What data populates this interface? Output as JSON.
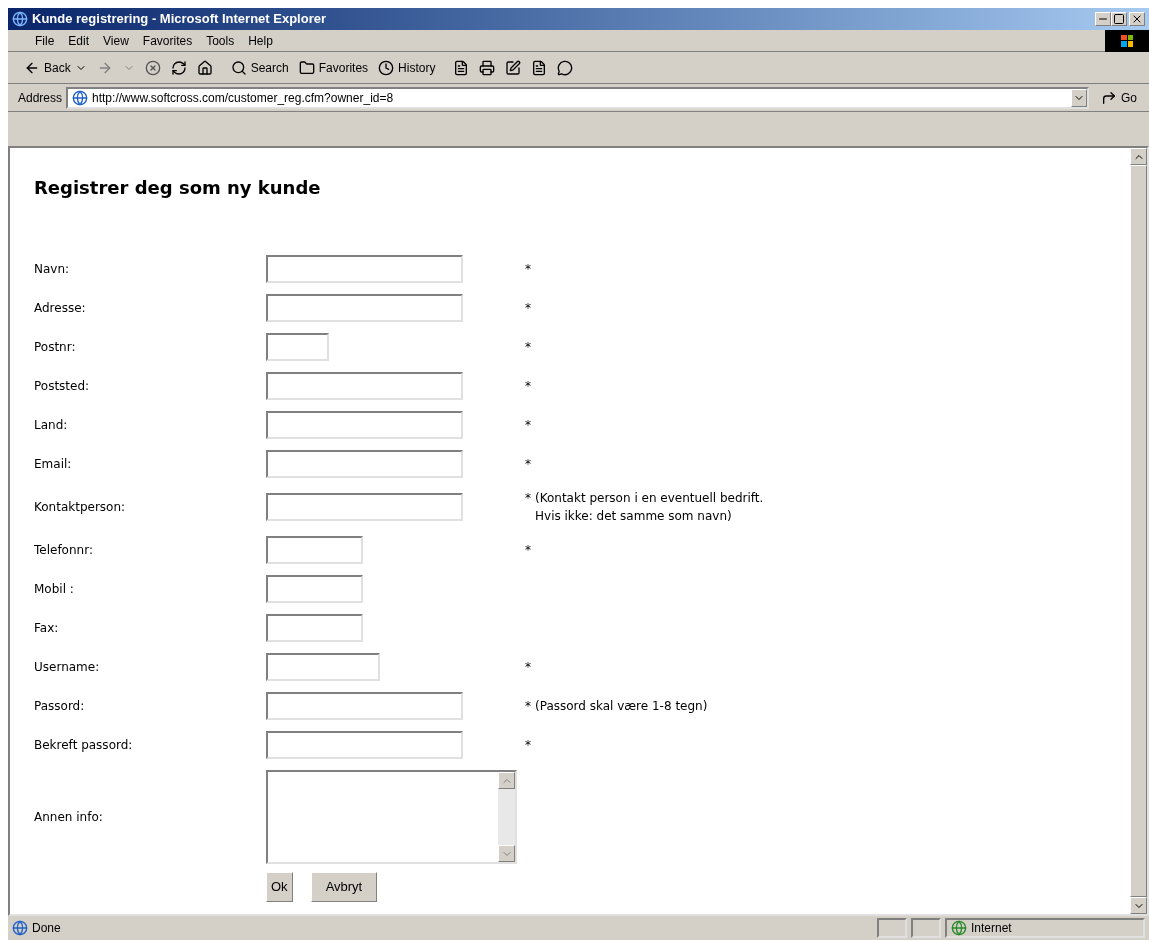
{
  "window": {
    "title": "Kunde registrering - Microsoft Internet Explorer"
  },
  "menu": [
    "File",
    "Edit",
    "View",
    "Favorites",
    "Tools",
    "Help"
  ],
  "toolbar": {
    "back": "Back",
    "search": "Search",
    "favorites": "Favorites",
    "history": "History"
  },
  "address": {
    "label": "Address",
    "url": "http://www.softcross.com/customer_reg.cfm?owner_id=8",
    "go": "Go"
  },
  "page": {
    "heading": "Registrer deg som ny kunde",
    "fields": [
      {
        "label": "Navn:",
        "kind": "wide",
        "marker": "*"
      },
      {
        "label": "Adresse:",
        "kind": "wide",
        "marker": "*"
      },
      {
        "label": "Postnr:",
        "kind": "short",
        "marker": "*"
      },
      {
        "label": "Poststed:",
        "kind": "wide",
        "marker": "*"
      },
      {
        "label": "Land:",
        "kind": "wide",
        "marker": "*"
      },
      {
        "label": "Email:",
        "kind": "wide",
        "marker": "*"
      },
      {
        "label": "Kontaktperson:",
        "kind": "wide",
        "marker": "*",
        "note": "(Kontakt person i en eventuell bedrift.\nHvis ikke: det samme som navn)"
      },
      {
        "label": "Telefonnr:",
        "kind": "medium",
        "marker": "*"
      },
      {
        "label": "Mobil :",
        "kind": "medium"
      },
      {
        "label": "Fax:",
        "kind": "medium"
      },
      {
        "label": "Username:",
        "kind": "user",
        "marker": "*"
      },
      {
        "label": "Passord:",
        "kind": "wide",
        "marker": "*",
        "note": "(Passord skal være 1-8 tegn)"
      },
      {
        "label": "Bekreft passord:",
        "kind": "wide",
        "marker": "*"
      },
      {
        "label": "Annen info:",
        "kind": "textarea"
      }
    ],
    "buttons": [
      "Ok",
      "Avbryt"
    ]
  },
  "status_bar": {
    "text": "Done",
    "zone": "Internet"
  }
}
